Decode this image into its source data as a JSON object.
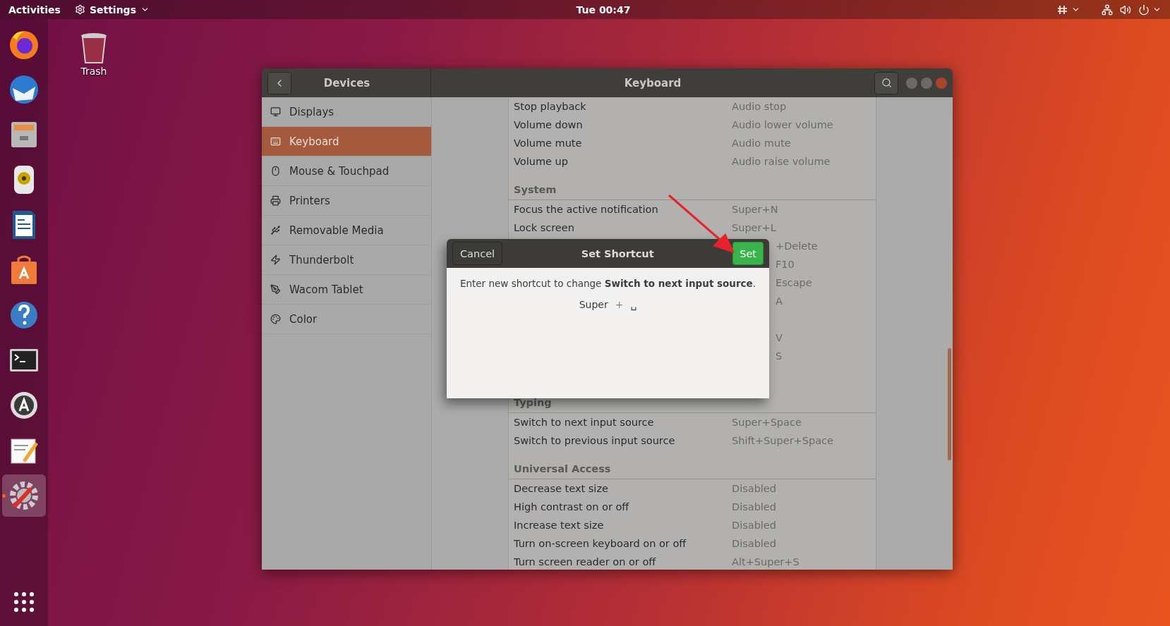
{
  "top_bar": {
    "activities": "Activities",
    "app_menu": "Settings",
    "clock": "Tue 00:47"
  },
  "dock": {
    "apps": [
      {
        "kind": "browser",
        "running": false
      },
      {
        "kind": "mail",
        "running": false
      },
      {
        "kind": "files",
        "running": false
      },
      {
        "kind": "music",
        "running": false
      },
      {
        "kind": "writer",
        "running": false
      },
      {
        "kind": "store",
        "running": false
      },
      {
        "kind": "help",
        "running": false
      },
      {
        "kind": "terminal",
        "running": false
      },
      {
        "kind": "updater",
        "running": false
      },
      {
        "kind": "editor",
        "running": false
      },
      {
        "kind": "settings",
        "running": true
      }
    ]
  },
  "desktop_icons": [
    {
      "label": "Trash"
    }
  ],
  "window": {
    "sidebar_title": "Devices",
    "title": "Keyboard",
    "sidebar": [
      {
        "label": "Displays",
        "selected": false
      },
      {
        "label": "Keyboard",
        "selected": true
      },
      {
        "label": "Mouse & Touchpad",
        "selected": false
      },
      {
        "label": "Printers",
        "selected": false
      },
      {
        "label": "Removable Media",
        "selected": false
      },
      {
        "label": "Thunderbolt",
        "selected": false
      },
      {
        "label": "Wacom Tablet",
        "selected": false
      },
      {
        "label": "Color",
        "selected": false
      }
    ],
    "shortcuts": [
      {
        "kind": "row",
        "name": "Stop playback",
        "accel": "Audio stop"
      },
      {
        "kind": "row",
        "name": "Volume down",
        "accel": "Audio lower volume"
      },
      {
        "kind": "row",
        "name": "Volume mute",
        "accel": "Audio mute"
      },
      {
        "kind": "row",
        "name": "Volume up",
        "accel": "Audio raise volume"
      },
      {
        "kind": "header",
        "name": "System"
      },
      {
        "kind": "row",
        "name": "Focus the active notification",
        "accel": "Super+N"
      },
      {
        "kind": "row",
        "name": "Lock screen",
        "accel": "Super+L"
      },
      {
        "kind": "covered",
        "accel": "+Delete"
      },
      {
        "kind": "covered",
        "accel": "F10"
      },
      {
        "kind": "covered",
        "accel": "Escape"
      },
      {
        "kind": "covered",
        "accel": "A"
      },
      {
        "kind": "blank"
      },
      {
        "kind": "covered",
        "accel": "V"
      },
      {
        "kind": "covered",
        "accel": "S"
      },
      {
        "kind": "blank"
      },
      {
        "kind": "header",
        "name": "Typing"
      },
      {
        "kind": "row",
        "name": "Switch to next input source",
        "accel": "Super+Space"
      },
      {
        "kind": "row",
        "name": "Switch to previous input source",
        "accel": "Shift+Super+Space"
      },
      {
        "kind": "header",
        "name": "Universal Access"
      },
      {
        "kind": "row",
        "name": "Decrease text size",
        "accel": "Disabled"
      },
      {
        "kind": "row",
        "name": "High contrast on or off",
        "accel": "Disabled"
      },
      {
        "kind": "row",
        "name": "Increase text size",
        "accel": "Disabled"
      },
      {
        "kind": "row",
        "name": "Turn on-screen keyboard on or off",
        "accel": "Disabled"
      },
      {
        "kind": "row",
        "name": "Turn screen reader on or off",
        "accel": "Alt+Super+S"
      }
    ]
  },
  "dialog": {
    "title": "Set Shortcut",
    "cancel": "Cancel",
    "confirm": "Set",
    "message": "Enter new shortcut to change **Switch to next input source**.",
    "keys": [
      "Super",
      "+",
      "␣"
    ]
  }
}
